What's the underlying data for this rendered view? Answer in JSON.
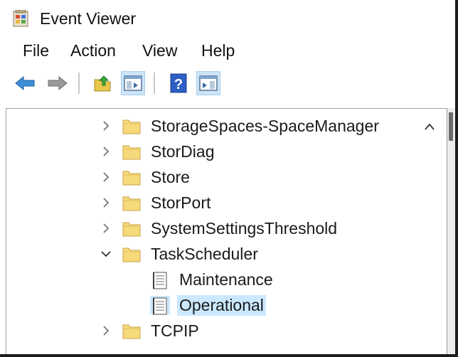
{
  "window": {
    "title": "Event Viewer"
  },
  "menu": {
    "items": [
      "File",
      "Action",
      "View",
      "Help"
    ]
  },
  "toolbar": {
    "buttons": [
      {
        "icon": "back-arrow-icon"
      },
      {
        "icon": "forward-arrow-icon"
      },
      {
        "icon": "up-folder-icon"
      },
      {
        "icon": "show-hide-console-tree-icon",
        "pressed": true
      },
      {
        "icon": "help-icon"
      },
      {
        "icon": "show-hide-action-pane-icon",
        "pressed": true
      }
    ]
  },
  "tree": {
    "items": [
      {
        "label": "StorageSpaces-SpaceManager",
        "type": "folder",
        "state": "collapsed"
      },
      {
        "label": "StorDiag",
        "type": "folder",
        "state": "collapsed"
      },
      {
        "label": "Store",
        "type": "folder",
        "state": "collapsed"
      },
      {
        "label": "StorPort",
        "type": "folder",
        "state": "collapsed"
      },
      {
        "label": "SystemSettingsThreshold",
        "type": "folder",
        "state": "collapsed"
      },
      {
        "label": "TaskScheduler",
        "type": "folder",
        "state": "expanded"
      },
      {
        "label": "Maintenance",
        "type": "log",
        "state": "leaf"
      },
      {
        "label": "Operational",
        "type": "log",
        "state": "leaf",
        "selected": true
      },
      {
        "label": "TCPIP",
        "type": "folder",
        "state": "collapsed"
      }
    ]
  },
  "colors": {
    "selection": "#cce8ff",
    "folder": "#f5d76e",
    "pressed": "#cce4f7"
  }
}
